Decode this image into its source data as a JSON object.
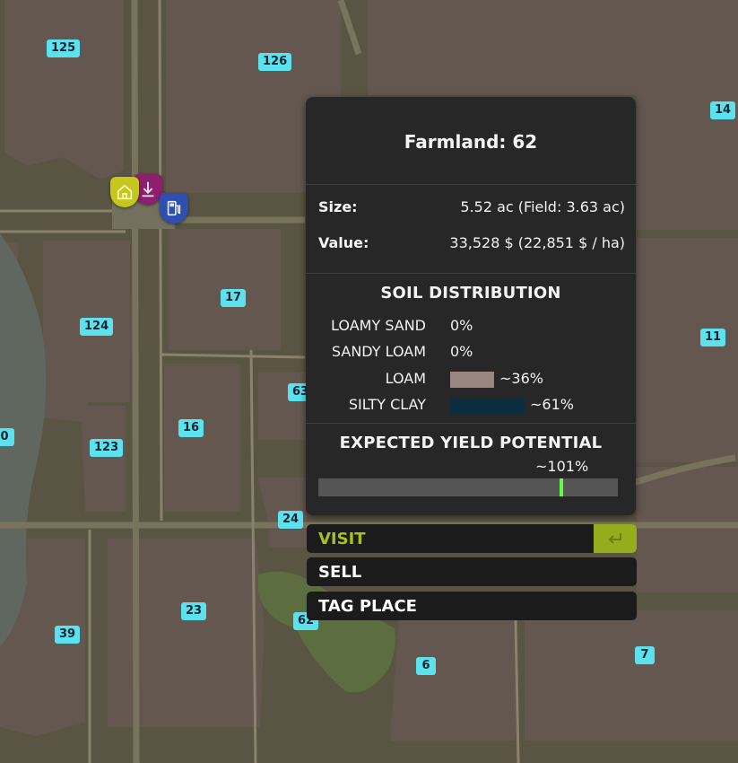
{
  "map": {
    "field_labels": [
      {
        "id": "125",
        "text": "125"
      },
      {
        "id": "126",
        "text": "126"
      },
      {
        "id": "14",
        "text": "14"
      },
      {
        "id": "17",
        "text": "17"
      },
      {
        "id": "124",
        "text": "124"
      },
      {
        "id": "11",
        "text": "11"
      },
      {
        "id": "63",
        "text": "63"
      },
      {
        "id": "0",
        "text": "0"
      },
      {
        "id": "16",
        "text": "16"
      },
      {
        "id": "123",
        "text": "123"
      },
      {
        "id": "24",
        "text": "24"
      },
      {
        "id": "23",
        "text": "23"
      },
      {
        "id": "62",
        "text": "62"
      },
      {
        "id": "39",
        "text": "39"
      },
      {
        "id": "6",
        "text": "6"
      },
      {
        "id": "7",
        "text": "7"
      }
    ],
    "poi_icons": [
      "home-icon",
      "sell-point-icon",
      "fuel-station-icon"
    ],
    "colors": {
      "label_bg": "#5ce1ef",
      "home": "#c6c61c",
      "sell": "#8c1f6e",
      "fuel": "#2e4fb0"
    }
  },
  "panel": {
    "title": "Farmland: 62",
    "size_label": "Size:",
    "size_value": "5.52 ac (Field: 3.63 ac)",
    "value_label": "Value:",
    "value_value": "33,528 $ (22,851 $ / ha)",
    "soil_title": "SOIL DISTRIBUTION",
    "soil": [
      {
        "name": "LOAMY SAND",
        "pct": "0%",
        "fraction": 0,
        "color": "#9a8880"
      },
      {
        "name": "SANDY LOAM",
        "pct": "0%",
        "fraction": 0,
        "color": "#9a8880"
      },
      {
        "name": "LOAM",
        "pct": "~36%",
        "fraction": 0.36,
        "color": "#9a8880"
      },
      {
        "name": "SILTY CLAY",
        "pct": "~61%",
        "fraction": 0.61,
        "color": "#0c2d3d"
      }
    ],
    "yield_title": "EXPECTED YIELD POTENTIAL",
    "yield_pct": "~101%",
    "yield_fraction": 0.805
  },
  "actions": {
    "visit": "VISIT",
    "sell": "SELL",
    "tag_place": "TAG PLACE",
    "enter_icon": "enter-key-icon",
    "accent": "#a4c21b"
  }
}
